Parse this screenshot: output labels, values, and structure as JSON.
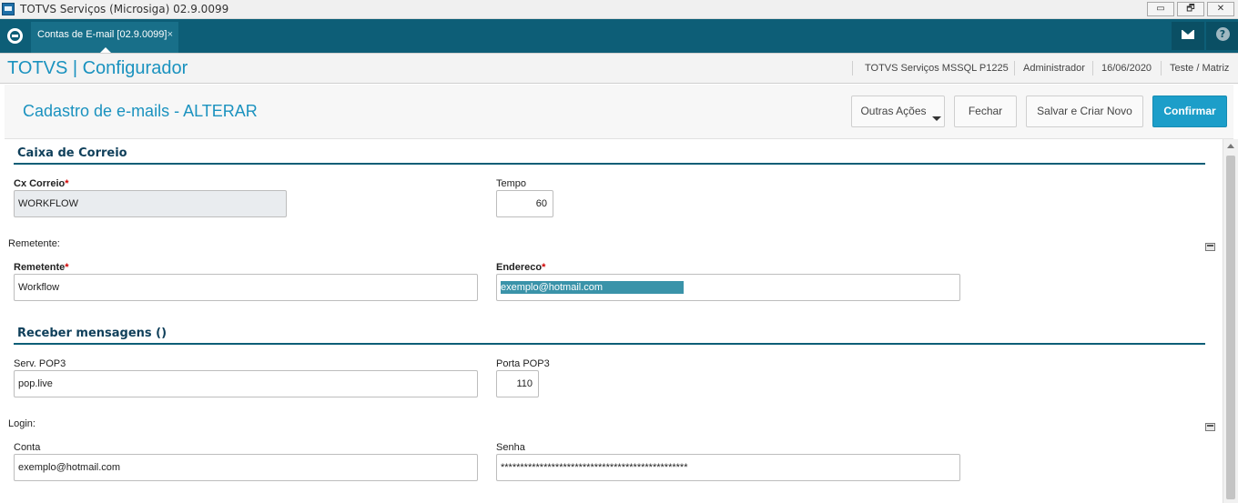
{
  "window": {
    "title": "TOTVS Serviços (Microsiga) 02.9.0099",
    "minimize": "▭",
    "restore": "🗗",
    "close": "✕"
  },
  "tabbar": {
    "tab_label": "Contas de E-mail [02.9.0099]",
    "tab_close": "×",
    "help_glyph": "?"
  },
  "header": {
    "brand": "TOTVS | Configurador",
    "environment": "TOTVS Serviços MSSQL P1225",
    "user": "Administrador",
    "date": "16/06/2020",
    "company": "Teste / Matriz"
  },
  "actionbar": {
    "title": "Cadastro de e-mails - ALTERAR",
    "more_actions": "Outras Ações",
    "close": "Fechar",
    "save_new": "Salvar e Criar Novo",
    "confirm": "Confirmar"
  },
  "mailbox": {
    "section_title": "Caixa de Correio",
    "mailbox_label": "Cx Correio",
    "mailbox_value": "WORKFLOW",
    "time_label": "Tempo",
    "time_value": "60",
    "sender_group": "Remetente:",
    "sender_label": "Remetente",
    "sender_value": "Workflow",
    "address_label": "Endereco",
    "address_value": "exemplo@hotmail.com",
    "required_mark": "*"
  },
  "receive": {
    "section_title": "Receber mensagens ()",
    "pop_server_label": "Serv. POP3",
    "pop_server_value": "pop.live",
    "pop_port_label": "Porta POP3",
    "pop_port_value": "110",
    "login_group": "Login:",
    "account_label": "Conta",
    "account_value": "exemplo@hotmail.com",
    "password_label": "Senha",
    "password_value": "************************************************"
  }
}
